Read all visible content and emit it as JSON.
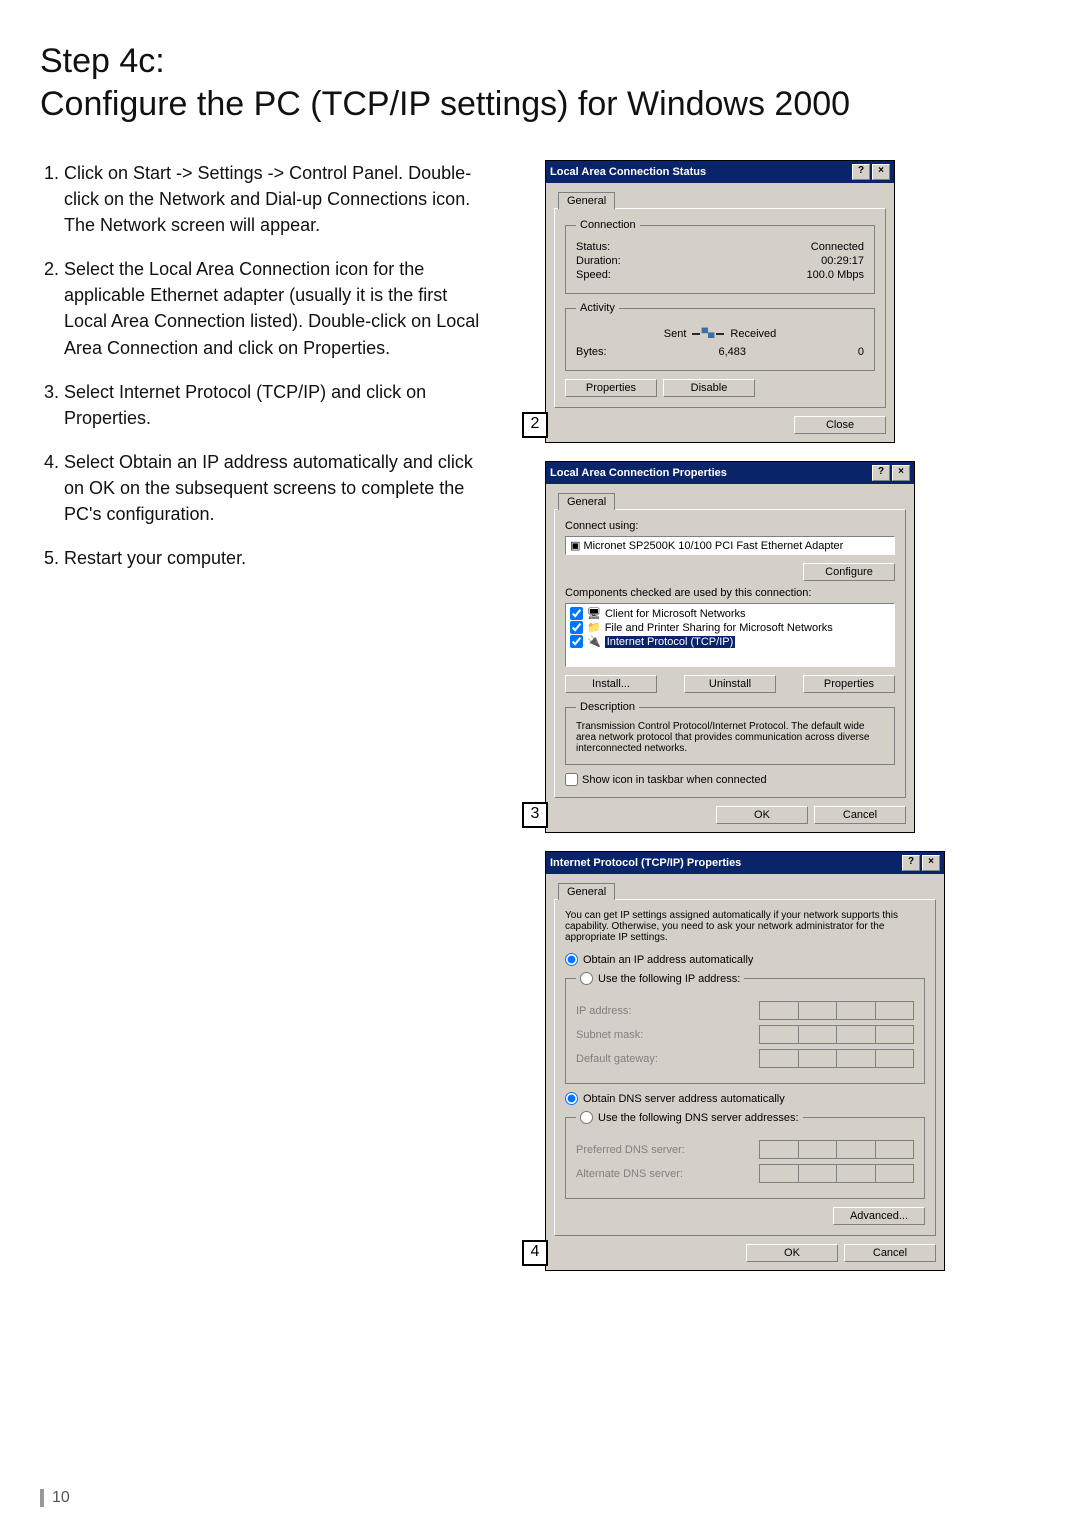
{
  "heading": "Step 4c:\nConfigure the PC (TCP/IP settings) for Windows 2000",
  "steps": [
    "Click on Start -> Settings -> Control Panel. Double-click on the Network and Dial-up Connections icon. The Network screen will appear.",
    "Select the Local Area Connection icon for the applicable Ethernet adapter (usually it is the first Local Area Connection listed). Double-click on Local Area Connection and click on Properties.",
    "Select Internet Protocol (TCP/IP) and click on Properties.",
    "Select Obtain an IP address automatically and click on OK on the subsequent screens to complete the PC's configuration.",
    "Restart your computer."
  ],
  "common": {
    "help_btn": "?",
    "close_btn": "×",
    "general_tab": "General",
    "ok": "OK",
    "cancel": "Cancel"
  },
  "dlg2": {
    "title": "Local Area Connection Status",
    "conn_legend": "Connection",
    "status_lbl": "Status:",
    "status_val": "Connected",
    "duration_lbl": "Duration:",
    "duration_val": "00:29:17",
    "speed_lbl": "Speed:",
    "speed_val": "100.0 Mbps",
    "act_legend": "Activity",
    "sent": "Sent",
    "received": "Received",
    "bytes_lbl": "Bytes:",
    "bytes_sent": "6,483",
    "bytes_recv": "0",
    "properties": "Properties",
    "disable": "Disable",
    "close": "Close",
    "callout": "2"
  },
  "dlg3": {
    "title": "Local Area Connection Properties",
    "connect_using": "Connect using:",
    "adapter": "Micronet SP2500K 10/100 PCI Fast Ethernet Adapter",
    "configure": "Configure",
    "components_lbl": "Components checked are used by this connection:",
    "items": [
      "Client for Microsoft Networks",
      "File and Printer Sharing for Microsoft Networks",
      "Internet Protocol (TCP/IP)"
    ],
    "install": "Install...",
    "uninstall": "Uninstall",
    "properties": "Properties",
    "desc_legend": "Description",
    "desc_text": "Transmission Control Protocol/Internet Protocol. The default wide area network protocol that provides communication across diverse interconnected networks.",
    "show_icon": "Show icon in taskbar when connected",
    "callout": "3"
  },
  "dlg4": {
    "title": "Internet Protocol (TCP/IP) Properties",
    "intro": "You can get IP settings assigned automatically if your network supports this capability. Otherwise, you need to ask your network administrator for the appropriate IP settings.",
    "obtain_ip": "Obtain an IP address automatically",
    "use_ip": "Use the following IP address:",
    "ip_addr": "IP address:",
    "subnet": "Subnet mask:",
    "gateway": "Default gateway:",
    "obtain_dns": "Obtain DNS server address automatically",
    "use_dns": "Use the following DNS server addresses:",
    "pref_dns": "Preferred DNS server:",
    "alt_dns": "Alternate DNS server:",
    "advanced": "Advanced...",
    "callout": "4"
  },
  "page_number": "10"
}
